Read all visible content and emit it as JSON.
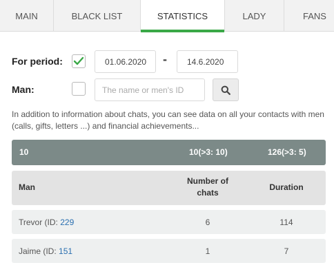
{
  "tabs": [
    {
      "label": "MAIN",
      "active": false
    },
    {
      "label": "BLACK LIST",
      "active": false
    },
    {
      "label": "STATISTICS",
      "active": true
    },
    {
      "label": "LADY",
      "active": false
    },
    {
      "label": "FANS",
      "active": false
    }
  ],
  "filter": {
    "period_label": "For period:",
    "period_checked": true,
    "date_from": "01.06.2020",
    "separator": "-",
    "date_to": "14.6.2020",
    "man_label": "Man:",
    "man_checked": false,
    "man_placeholder": "The name or men's ID"
  },
  "info_text": "In addition to information about chats, you can see data on all your contacts with men (calls, gifts, letters ...) and financial achievements...",
  "summary": {
    "count": "10",
    "chats": "10(>3: 10)",
    "duration": "126(>3: 5)"
  },
  "table": {
    "headers": {
      "man": "Man",
      "chats_line1": "Number of",
      "chats_line2": "chats",
      "duration": "Duration"
    },
    "rows": [
      {
        "name": "Trevor (ID: ",
        "id": "229",
        "chats": "6",
        "duration": "114"
      },
      {
        "name": "Jaime (ID: ",
        "id": "151",
        "chats": "1",
        "duration": "7"
      }
    ]
  },
  "colors": {
    "accent": "#3aa847",
    "summary_bg": "#7c8a88",
    "link": "#2a6fb0"
  },
  "icons": {
    "check": "check-icon",
    "search": "search-icon"
  }
}
